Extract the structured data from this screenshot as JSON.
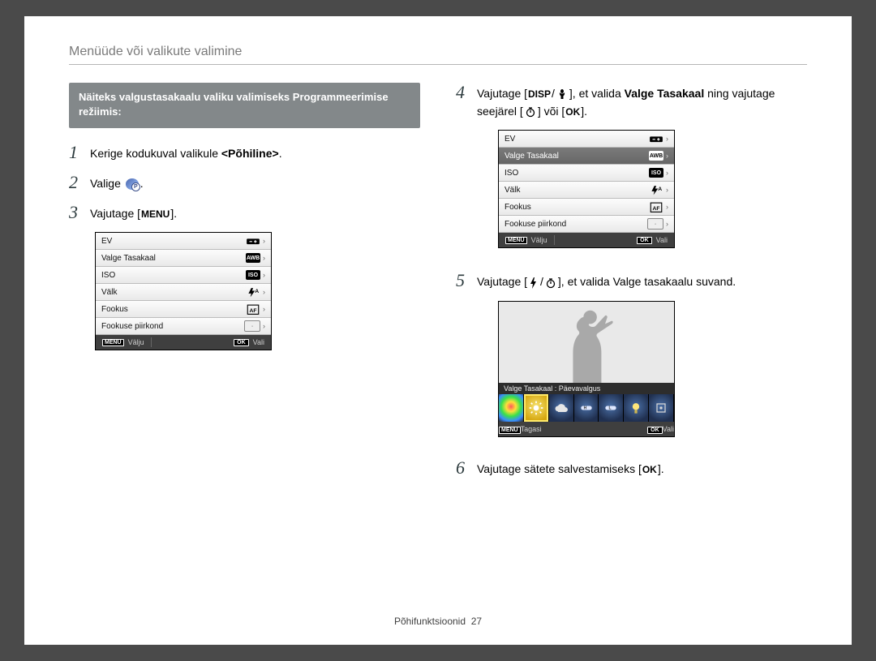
{
  "heading": "Menüüde või valikute valimine",
  "intro": "Näiteks valgustasakaalu valiku valimiseks Programmeerimise režiimis:",
  "steps": {
    "s1": {
      "num": "1",
      "text_a": "Kerige kodukuval valikule ",
      "bold": "<Põhiline>",
      "text_b": "."
    },
    "s2": {
      "num": "2",
      "text_a": "Valige ",
      "text_b": "."
    },
    "s3": {
      "num": "3",
      "text_a": "Vajutage [",
      "key": "MENU",
      "text_b": "]."
    },
    "s4": {
      "num": "4",
      "text_a": "Vajutage [",
      "text_b": "], et valida ",
      "bold": "Valge Tasakaal",
      "text_c": " ning vajutage seejärel [",
      "text_d": "] või [",
      "text_e": "]."
    },
    "s5": {
      "num": "5",
      "text_a": "Vajutage [",
      "text_b": "], et valida Valge tasakaalu suvand."
    },
    "s6": {
      "num": "6",
      "text_a": "Vajutage sätete salvestamiseks [",
      "text_b": "]."
    }
  },
  "keys": {
    "disp": "DISP",
    "ok": "OK"
  },
  "menu_items": {
    "ev": "EV",
    "wb": "Valge Tasakaal",
    "iso": "ISO",
    "flash": "Välk",
    "focus": "Fookus",
    "focus_area": "Fookuse piirkond"
  },
  "menu_values": {
    "iso": "ISO",
    "wb": "AWB",
    "flash": "A",
    "focus": "AF",
    "area": "·"
  },
  "menu_footer": {
    "menu_chip": "MENU",
    "exit": "Välju",
    "ok_chip": "OK",
    "select": "Vali",
    "back": "Tagasi"
  },
  "wb_strip": "Valge Tasakaal : Päevavalgus",
  "footer": {
    "label": "Põhifunktsioonid",
    "page": "27"
  }
}
